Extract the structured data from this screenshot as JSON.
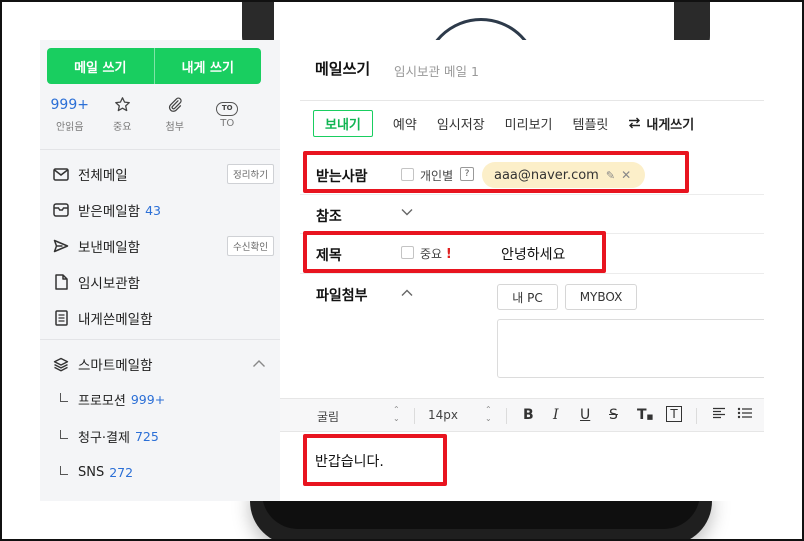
{
  "sidebar": {
    "write_mail": "메일 쓰기",
    "write_to_me": "내게 쓰기",
    "quick": {
      "unread_count": "999+",
      "unread_label": "안읽음",
      "important_label": "중요",
      "attach_label": "첨부",
      "to_badge": "TO",
      "to_label": "TO"
    },
    "folders": {
      "all": {
        "label": "전체메일",
        "tag": "정리하기"
      },
      "inbox": {
        "label": "받은메일함",
        "count": "43"
      },
      "sent": {
        "label": "보낸메일함",
        "tag": "수신확인"
      },
      "drafts": {
        "label": "임시보관함"
      },
      "self": {
        "label": "내게쓴메일함"
      },
      "smart": {
        "label": "스마트메일함"
      }
    },
    "smart_sub": [
      {
        "label": "프로모션",
        "count": "999+"
      },
      {
        "label": "청구·결제",
        "count": "725"
      },
      {
        "label": "SNS",
        "count": "272"
      }
    ]
  },
  "compose": {
    "title": "메일쓰기",
    "subtitle": "임시보관 메일 1",
    "toolbar": {
      "send": "보내기",
      "reserve": "예약",
      "save": "임시저장",
      "preview": "미리보기",
      "template": "템플릿",
      "to_self": "내게쓰기"
    },
    "recipient": {
      "label": "받는사람",
      "individual": "개인별",
      "help": "?",
      "email": "aaa@naver.com"
    },
    "cc": {
      "label": "참조"
    },
    "subject": {
      "label": "제목",
      "important": "중요",
      "excl": "!",
      "value": "안녕하세요"
    },
    "attachment": {
      "label": "파일첨부",
      "my_pc": "내 PC",
      "mybox": "MYBOX"
    },
    "editor": {
      "font": "굴림",
      "size": "14px",
      "bold": "B",
      "italic": "I",
      "underline": "U",
      "strike": "S",
      "font_color": "T",
      "bg_color": "T"
    },
    "body": "반갑습니다."
  },
  "colors": {
    "brand_green": "#19ce60",
    "link_blue": "#2b6fd6",
    "highlight_red": "#e8141f",
    "chip_bg": "#fcefc9"
  }
}
